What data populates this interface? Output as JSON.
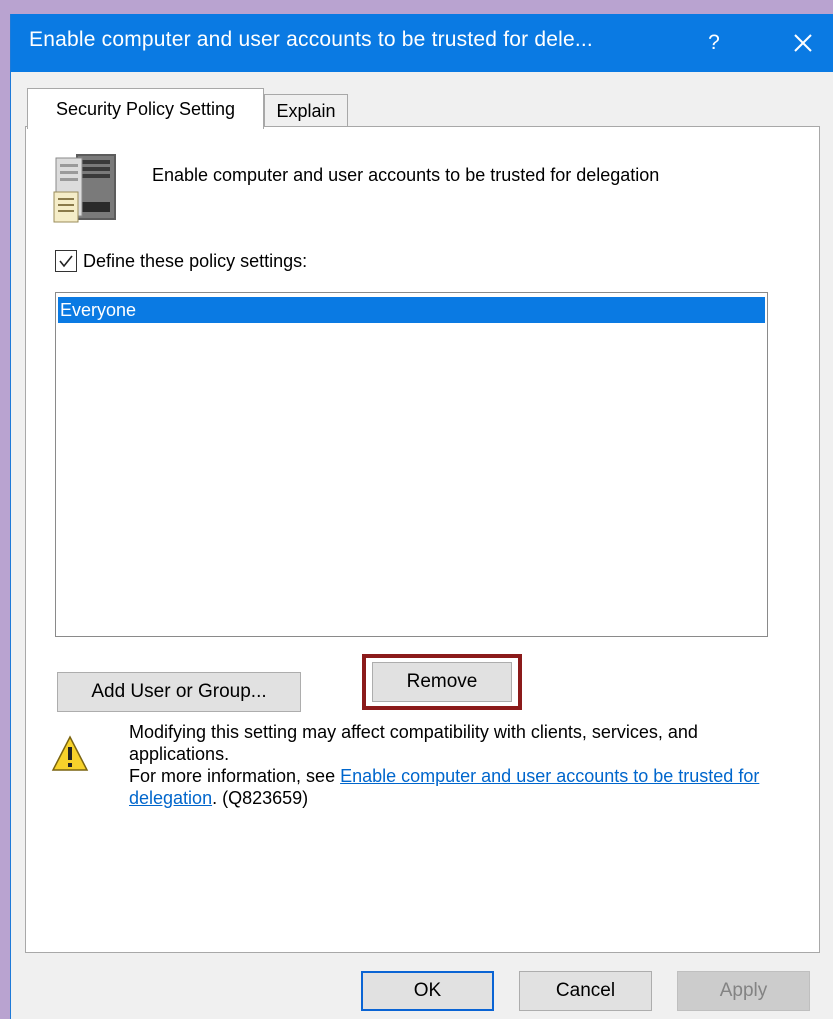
{
  "window": {
    "title": "Enable computer and user accounts to be trusted for dele...",
    "help_label": "?",
    "accent_color": "#0a7ae3"
  },
  "tabs": [
    {
      "label": "Security Policy Setting",
      "active": true
    },
    {
      "label": "Explain",
      "active": false
    }
  ],
  "policy": {
    "icon": "server-policy-icon",
    "title": "Enable computer and user accounts to be trusted for delegation"
  },
  "define": {
    "checked": true,
    "label": "Define these policy settings:"
  },
  "list": {
    "items": [
      "Everyone"
    ]
  },
  "buttons": {
    "add_label": "Add User or Group...",
    "remove_label": "Remove"
  },
  "warning": {
    "icon": "warning-icon",
    "line1": "Modifying this setting may affect compatibility with clients, services, and applications.",
    "line2_prefix": "For more information, see ",
    "link_text": "Enable computer and user accounts to be trusted for delegation",
    "line2_suffix": ". (Q823659)"
  },
  "footer": {
    "ok_label": "OK",
    "cancel_label": "Cancel",
    "apply_label": "Apply"
  }
}
